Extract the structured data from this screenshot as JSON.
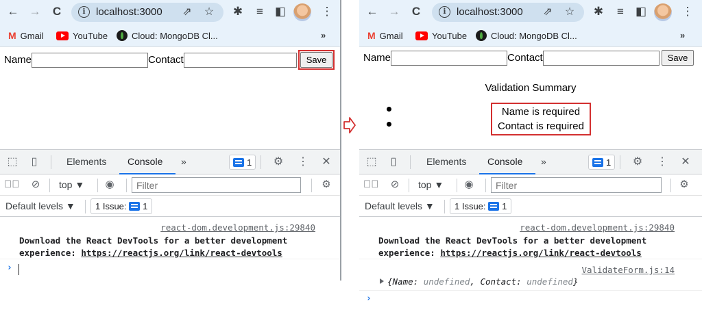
{
  "browser": {
    "url": "localhost:3000",
    "bookmarks": {
      "gmail": "Gmail",
      "youtube": "YouTube",
      "mongodb": "Cloud: MongoDB Cl...",
      "more": "»"
    }
  },
  "form": {
    "name_label": "Name",
    "contact_label": "Contact",
    "save_label": "Save"
  },
  "validation": {
    "title": "Validation Summary",
    "errors": [
      "Name is required",
      "Contact is required"
    ]
  },
  "devtools": {
    "tabs": [
      "Elements",
      "Console"
    ],
    "more_tabs": "»",
    "issues_count": "1",
    "context": "top ▼",
    "filter_placeholder": "Filter",
    "levels": "Default levels ▼",
    "issue_label": "1 Issue:",
    "issue_count": "1"
  },
  "console": {
    "react_source": "react-dom.development.js:29840",
    "react_message": "Download the React DevTools for a better development",
    "react_message_2": "experience: ",
    "react_link": "https://reactjs.org/link/react-devtools",
    "validate_source": "ValidateForm.js:14",
    "obj_open": "{",
    "obj_key1": "Name: ",
    "obj_val1": "undefined",
    "obj_sep": ", ",
    "obj_key2": "Contact: ",
    "obj_val2": "undefined",
    "obj_close": "}",
    "prompt": "›"
  },
  "colors": {
    "highlight": "#d32f2f",
    "accent": "#1a73e8",
    "chrome_bg": "#e8f2fb"
  },
  "icons": [
    "back-arrow-icon",
    "forward-arrow-icon",
    "reload-icon",
    "info-icon",
    "share-icon",
    "star-icon",
    "extension-icon",
    "media-icon",
    "sidepanel-icon",
    "kebab-menu-icon",
    "inspect-icon",
    "device-icon",
    "gear-icon",
    "close-icon",
    "sidebar-toggle-icon",
    "block-icon",
    "eye-icon"
  ]
}
